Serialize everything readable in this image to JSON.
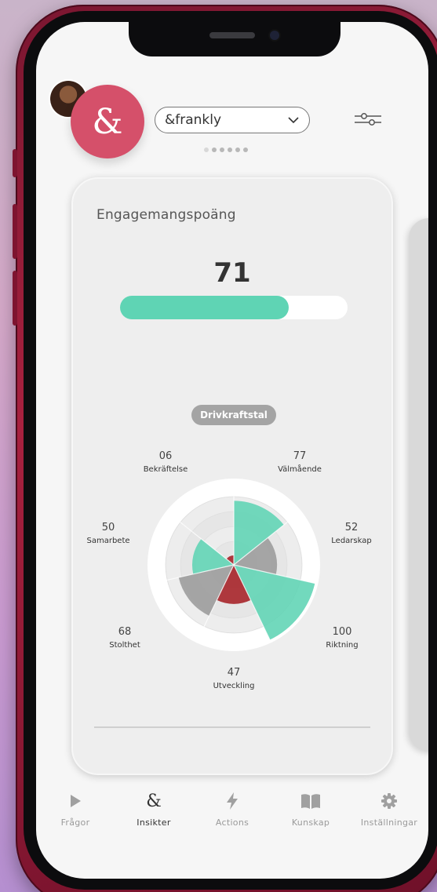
{
  "org_select": {
    "value": "&frankly"
  },
  "brand": {
    "glyph": "&"
  },
  "pager": {
    "count": 6,
    "active": 0
  },
  "card": {
    "title": "Engagemangspoäng",
    "score": "71",
    "progress": 0.74,
    "pill": "Drivkraftstal"
  },
  "radar": {
    "labels": [
      {
        "value": "06",
        "name": "Bekräftelse"
      },
      {
        "value": "77",
        "name": "Välmående"
      },
      {
        "value": "52",
        "name": "Ledarskap"
      },
      {
        "value": "100",
        "name": "Riktning"
      },
      {
        "value": "47",
        "name": "Utveckling"
      },
      {
        "value": "68",
        "name": "Stolthet"
      },
      {
        "value": "50",
        "name": "Samarbete"
      }
    ]
  },
  "chart_data": {
    "type": "polar-area",
    "categories": [
      "Välmående",
      "Ledarskap",
      "Riktning",
      "Utveckling",
      "Stolthet",
      "Samarbete",
      "Bekräftelse"
    ],
    "values": [
      77,
      52,
      100,
      47,
      68,
      50,
      6
    ]
  },
  "nav": {
    "items": [
      {
        "label": "Frågor",
        "icon": "play-icon"
      },
      {
        "label": "Insikter",
        "icon": "ampersand-icon"
      },
      {
        "label": "Actions",
        "icon": "bolt-icon"
      },
      {
        "label": "Kunskap",
        "icon": "book-icon"
      },
      {
        "label": "Inställningar",
        "icon": "gear-icon"
      }
    ],
    "active": "Insikter"
  },
  "colors": {
    "brand": "#d5506a",
    "teal": "#5fd4b4",
    "teal_light": "#6ee8cc",
    "grey_segment": "#9e9e9e",
    "red_segment": "#a8282e"
  }
}
